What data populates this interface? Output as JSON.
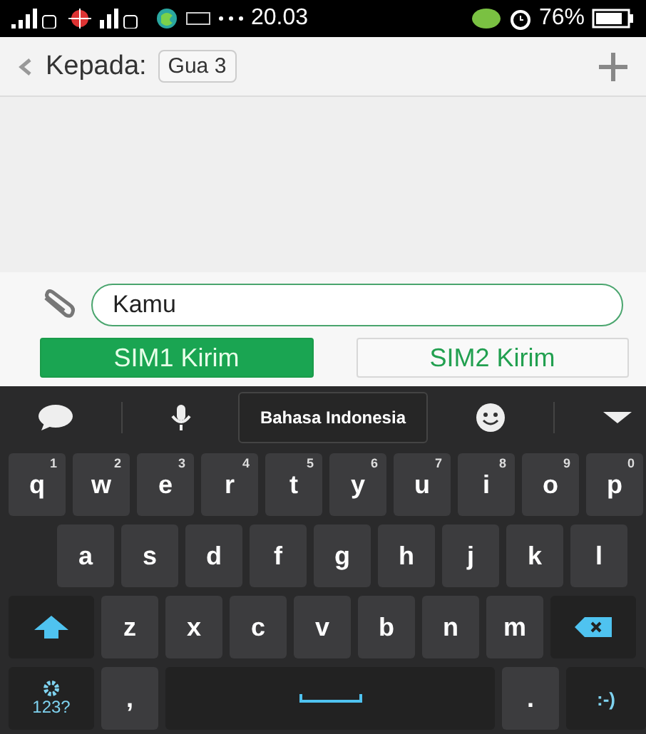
{
  "status_bar": {
    "time": "20.03",
    "battery": "76%"
  },
  "header": {
    "to_label": "Kepada:",
    "recipient": "Gua 3"
  },
  "compose": {
    "value": "Kamu"
  },
  "send_buttons": [
    {
      "label": "SIM1 Kirim",
      "selected": true
    },
    {
      "label": "SIM2 Kirim",
      "selected": false
    }
  ],
  "keyboard": {
    "language": "Bahasa Indonesia",
    "rows": [
      [
        {
          "kind": "letter",
          "label": "q",
          "hint": "1"
        },
        {
          "kind": "letter",
          "label": "w",
          "hint": "2"
        },
        {
          "kind": "letter",
          "label": "e",
          "hint": "3"
        },
        {
          "kind": "letter",
          "label": "r",
          "hint": "4"
        },
        {
          "kind": "letter",
          "label": "t",
          "hint": "5"
        },
        {
          "kind": "letter",
          "label": "y",
          "hint": "6"
        },
        {
          "kind": "letter",
          "label": "u",
          "hint": "7"
        },
        {
          "kind": "letter",
          "label": "i",
          "hint": "8"
        },
        {
          "kind": "letter",
          "label": "o",
          "hint": "9"
        },
        {
          "kind": "letter",
          "label": "p",
          "hint": "0"
        }
      ],
      [
        {
          "kind": "letter",
          "label": "a"
        },
        {
          "kind": "letter",
          "label": "s"
        },
        {
          "kind": "letter",
          "label": "d"
        },
        {
          "kind": "letter",
          "label": "f"
        },
        {
          "kind": "letter",
          "label": "g"
        },
        {
          "kind": "letter",
          "label": "h"
        },
        {
          "kind": "letter",
          "label": "j"
        },
        {
          "kind": "letter",
          "label": "k"
        },
        {
          "kind": "letter",
          "label": "l"
        }
      ],
      [
        {
          "kind": "shift"
        },
        {
          "kind": "letter",
          "label": "z"
        },
        {
          "kind": "letter",
          "label": "x"
        },
        {
          "kind": "letter",
          "label": "c"
        },
        {
          "kind": "letter",
          "label": "v"
        },
        {
          "kind": "letter",
          "label": "b"
        },
        {
          "kind": "letter",
          "label": "n"
        },
        {
          "kind": "letter",
          "label": "m"
        },
        {
          "kind": "delete"
        }
      ],
      [
        {
          "kind": "symbols",
          "label": "123?"
        },
        {
          "kind": "letter",
          "label": ","
        },
        {
          "kind": "space"
        },
        {
          "kind": "letter",
          "label": "."
        },
        {
          "kind": "smiley",
          "label": ":-)"
        }
      ]
    ]
  }
}
